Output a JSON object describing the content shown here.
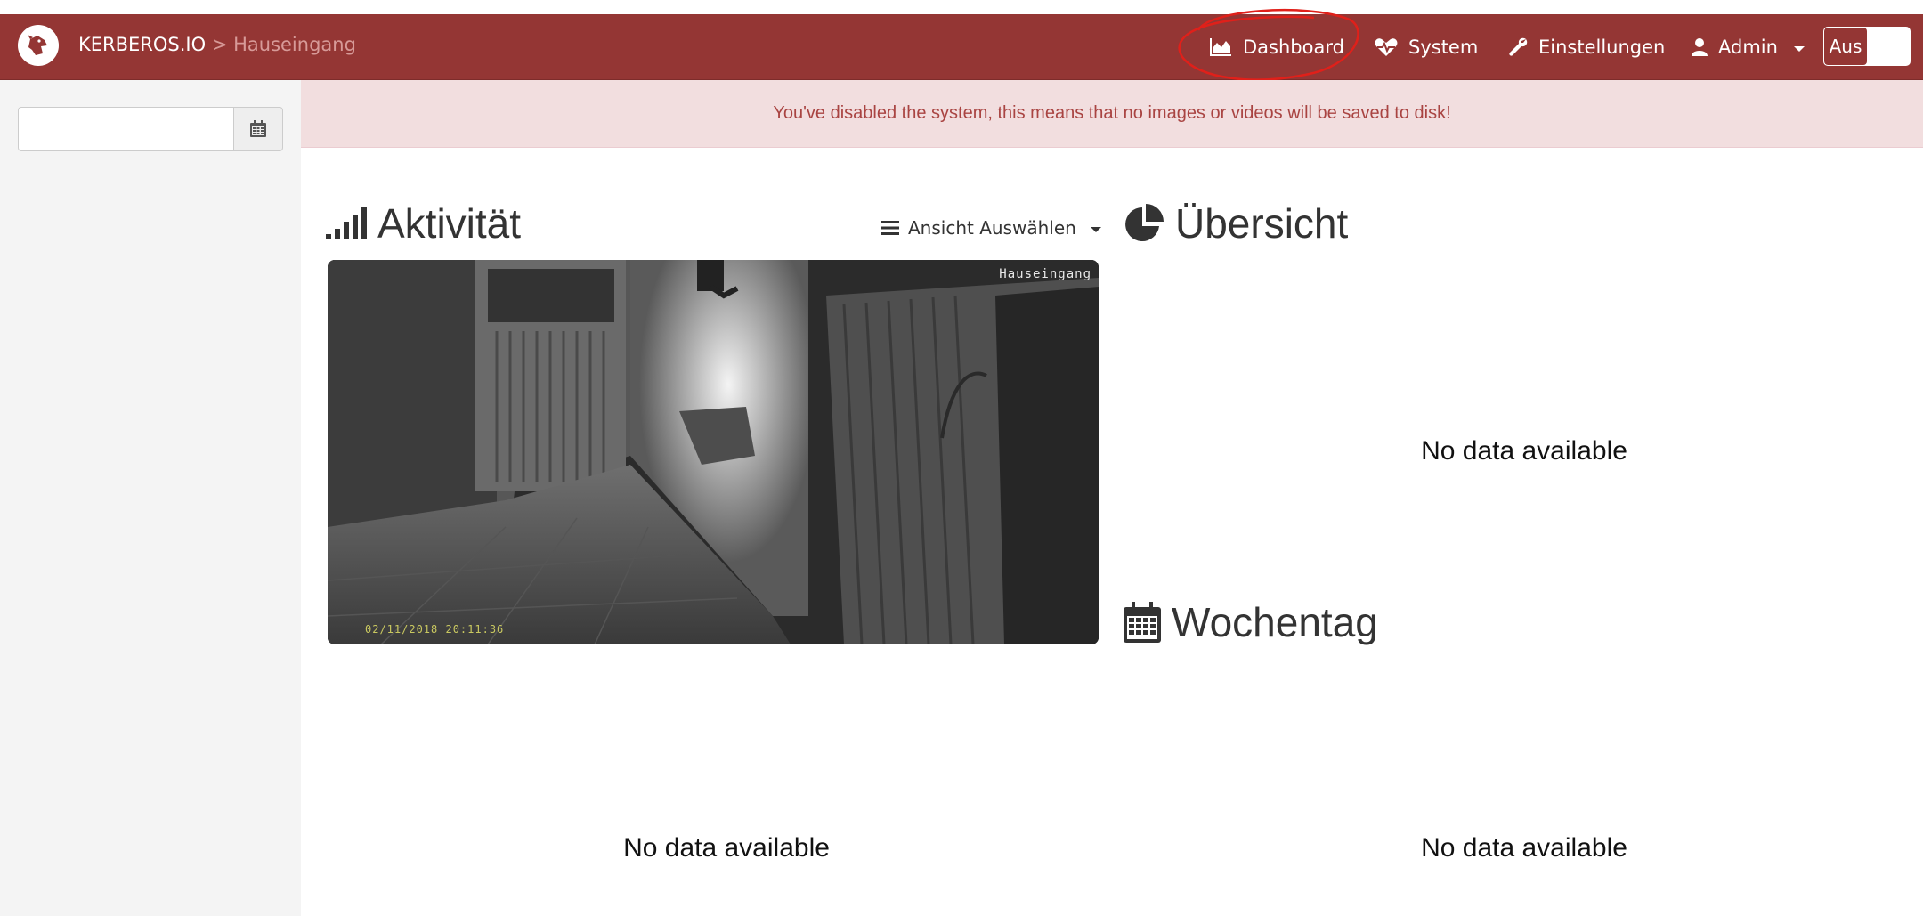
{
  "navbar": {
    "brand": "KERBEROS.IO",
    "breadcrumb": " > Hauseingang",
    "items": [
      {
        "label": "Dashboard",
        "icon": "area-chart-icon"
      },
      {
        "label": "System",
        "icon": "heartbeat-icon"
      },
      {
        "label": "Einstellungen",
        "icon": "wrench-icon"
      },
      {
        "label": "Admin",
        "icon": "user-icon"
      }
    ],
    "toggle_label": "Aus",
    "color": "#943634"
  },
  "sidebar": {
    "date_value": "",
    "date_placeholder": ""
  },
  "alert": {
    "text": "You've disabled the system, this means that no images or videos will be saved to disk!"
  },
  "activity": {
    "title": "Aktivität",
    "view_select": "Ansicht Auswählen",
    "camera_label": "Hauseingang",
    "camera_timestamp": "02/11/2018  20:11:36"
  },
  "overview": {
    "title": "Übersicht",
    "empty": "No data available"
  },
  "weekday": {
    "title": "Wochentag",
    "empty": "No data available"
  },
  "activity_chart": {
    "empty": "No data available"
  }
}
